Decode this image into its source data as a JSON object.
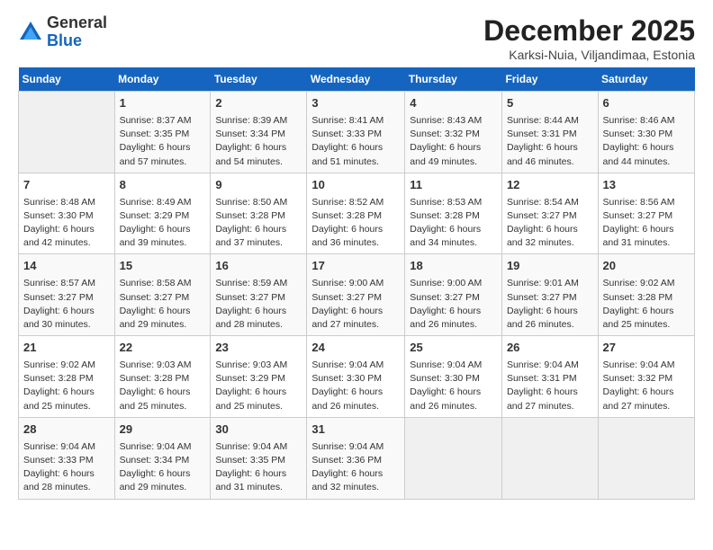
{
  "logo": {
    "text_general": "General",
    "text_blue": "Blue"
  },
  "title": "December 2025",
  "location": "Karksi-Nuia, Viljandimaa, Estonia",
  "days_of_week": [
    "Sunday",
    "Monday",
    "Tuesday",
    "Wednesday",
    "Thursday",
    "Friday",
    "Saturday"
  ],
  "weeks": [
    [
      {
        "num": "",
        "info": ""
      },
      {
        "num": "1",
        "info": "Sunrise: 8:37 AM\nSunset: 3:35 PM\nDaylight: 6 hours\nand 57 minutes."
      },
      {
        "num": "2",
        "info": "Sunrise: 8:39 AM\nSunset: 3:34 PM\nDaylight: 6 hours\nand 54 minutes."
      },
      {
        "num": "3",
        "info": "Sunrise: 8:41 AM\nSunset: 3:33 PM\nDaylight: 6 hours\nand 51 minutes."
      },
      {
        "num": "4",
        "info": "Sunrise: 8:43 AM\nSunset: 3:32 PM\nDaylight: 6 hours\nand 49 minutes."
      },
      {
        "num": "5",
        "info": "Sunrise: 8:44 AM\nSunset: 3:31 PM\nDaylight: 6 hours\nand 46 minutes."
      },
      {
        "num": "6",
        "info": "Sunrise: 8:46 AM\nSunset: 3:30 PM\nDaylight: 6 hours\nand 44 minutes."
      }
    ],
    [
      {
        "num": "7",
        "info": "Sunrise: 8:48 AM\nSunset: 3:30 PM\nDaylight: 6 hours\nand 42 minutes."
      },
      {
        "num": "8",
        "info": "Sunrise: 8:49 AM\nSunset: 3:29 PM\nDaylight: 6 hours\nand 39 minutes."
      },
      {
        "num": "9",
        "info": "Sunrise: 8:50 AM\nSunset: 3:28 PM\nDaylight: 6 hours\nand 37 minutes."
      },
      {
        "num": "10",
        "info": "Sunrise: 8:52 AM\nSunset: 3:28 PM\nDaylight: 6 hours\nand 36 minutes."
      },
      {
        "num": "11",
        "info": "Sunrise: 8:53 AM\nSunset: 3:28 PM\nDaylight: 6 hours\nand 34 minutes."
      },
      {
        "num": "12",
        "info": "Sunrise: 8:54 AM\nSunset: 3:27 PM\nDaylight: 6 hours\nand 32 minutes."
      },
      {
        "num": "13",
        "info": "Sunrise: 8:56 AM\nSunset: 3:27 PM\nDaylight: 6 hours\nand 31 minutes."
      }
    ],
    [
      {
        "num": "14",
        "info": "Sunrise: 8:57 AM\nSunset: 3:27 PM\nDaylight: 6 hours\nand 30 minutes."
      },
      {
        "num": "15",
        "info": "Sunrise: 8:58 AM\nSunset: 3:27 PM\nDaylight: 6 hours\nand 29 minutes."
      },
      {
        "num": "16",
        "info": "Sunrise: 8:59 AM\nSunset: 3:27 PM\nDaylight: 6 hours\nand 28 minutes."
      },
      {
        "num": "17",
        "info": "Sunrise: 9:00 AM\nSunset: 3:27 PM\nDaylight: 6 hours\nand 27 minutes."
      },
      {
        "num": "18",
        "info": "Sunrise: 9:00 AM\nSunset: 3:27 PM\nDaylight: 6 hours\nand 26 minutes."
      },
      {
        "num": "19",
        "info": "Sunrise: 9:01 AM\nSunset: 3:27 PM\nDaylight: 6 hours\nand 26 minutes."
      },
      {
        "num": "20",
        "info": "Sunrise: 9:02 AM\nSunset: 3:28 PM\nDaylight: 6 hours\nand 25 minutes."
      }
    ],
    [
      {
        "num": "21",
        "info": "Sunrise: 9:02 AM\nSunset: 3:28 PM\nDaylight: 6 hours\nand 25 minutes."
      },
      {
        "num": "22",
        "info": "Sunrise: 9:03 AM\nSunset: 3:28 PM\nDaylight: 6 hours\nand 25 minutes."
      },
      {
        "num": "23",
        "info": "Sunrise: 9:03 AM\nSunset: 3:29 PM\nDaylight: 6 hours\nand 25 minutes."
      },
      {
        "num": "24",
        "info": "Sunrise: 9:04 AM\nSunset: 3:30 PM\nDaylight: 6 hours\nand 26 minutes."
      },
      {
        "num": "25",
        "info": "Sunrise: 9:04 AM\nSunset: 3:30 PM\nDaylight: 6 hours\nand 26 minutes."
      },
      {
        "num": "26",
        "info": "Sunrise: 9:04 AM\nSunset: 3:31 PM\nDaylight: 6 hours\nand 27 minutes."
      },
      {
        "num": "27",
        "info": "Sunrise: 9:04 AM\nSunset: 3:32 PM\nDaylight: 6 hours\nand 27 minutes."
      }
    ],
    [
      {
        "num": "28",
        "info": "Sunrise: 9:04 AM\nSunset: 3:33 PM\nDaylight: 6 hours\nand 28 minutes."
      },
      {
        "num": "29",
        "info": "Sunrise: 9:04 AM\nSunset: 3:34 PM\nDaylight: 6 hours\nand 29 minutes."
      },
      {
        "num": "30",
        "info": "Sunrise: 9:04 AM\nSunset: 3:35 PM\nDaylight: 6 hours\nand 31 minutes."
      },
      {
        "num": "31",
        "info": "Sunrise: 9:04 AM\nSunset: 3:36 PM\nDaylight: 6 hours\nand 32 minutes."
      },
      {
        "num": "",
        "info": ""
      },
      {
        "num": "",
        "info": ""
      },
      {
        "num": "",
        "info": ""
      }
    ]
  ]
}
